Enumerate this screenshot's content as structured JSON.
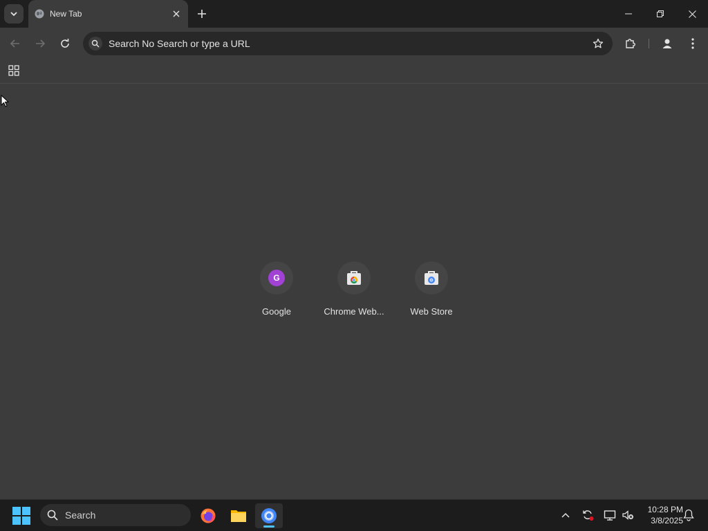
{
  "browser": {
    "tab": {
      "title": "New Tab"
    },
    "omnibox": {
      "placeholder": "Search No Search or type a URL"
    },
    "shortcuts": [
      {
        "label": "Google",
        "icon": "google-g-icon",
        "letter": "G"
      },
      {
        "label": "Chrome Web...",
        "icon": "chrome-web-store-icon"
      },
      {
        "label": "Web Store",
        "icon": "web-store-icon"
      }
    ]
  },
  "taskbar": {
    "search": {
      "label": "Search"
    },
    "apps": [
      "firefox-icon",
      "file-explorer-icon",
      "chrome-icon"
    ],
    "clock": {
      "time": "10:28 PM",
      "date": "3/8/2025"
    }
  },
  "colors": {
    "accent": "#4cc2ff",
    "google_tile": "#a142d4",
    "chrome_bg": "#3c3c3c",
    "tabstrip_bg": "#1f1f1f"
  }
}
